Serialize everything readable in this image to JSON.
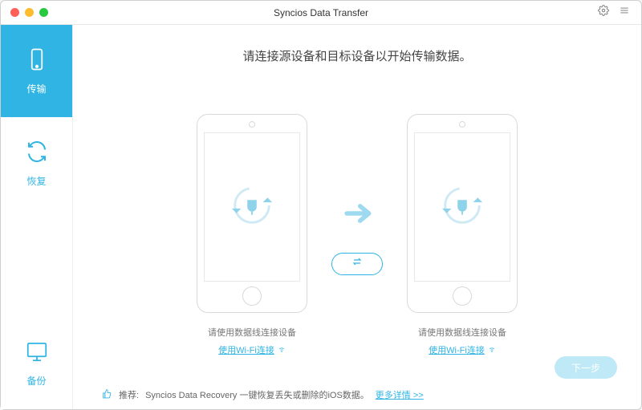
{
  "titlebar": {
    "title": "Syncios Data Transfer"
  },
  "sidebar": {
    "items": [
      {
        "label": "传输"
      },
      {
        "label": "恢复"
      },
      {
        "label": "备份"
      }
    ]
  },
  "main": {
    "headline": "请连接源设备和目标设备以开始传输数据。",
    "source": {
      "hint": "请使用数据线连接设备",
      "wifi_label": "使用Wi-Fi连接"
    },
    "target": {
      "hint": "请使用数据线连接设备",
      "wifi_label": "使用Wi-Fi连接"
    },
    "next_label": "下一步"
  },
  "footer": {
    "recommend_prefix": "推荐: ",
    "recommend_text": "Syncios Data Recovery 一键恢复丢失或删除的iOS数据。",
    "more_label": "更多详情 >>"
  },
  "colors": {
    "accent": "#2fb4e3"
  }
}
